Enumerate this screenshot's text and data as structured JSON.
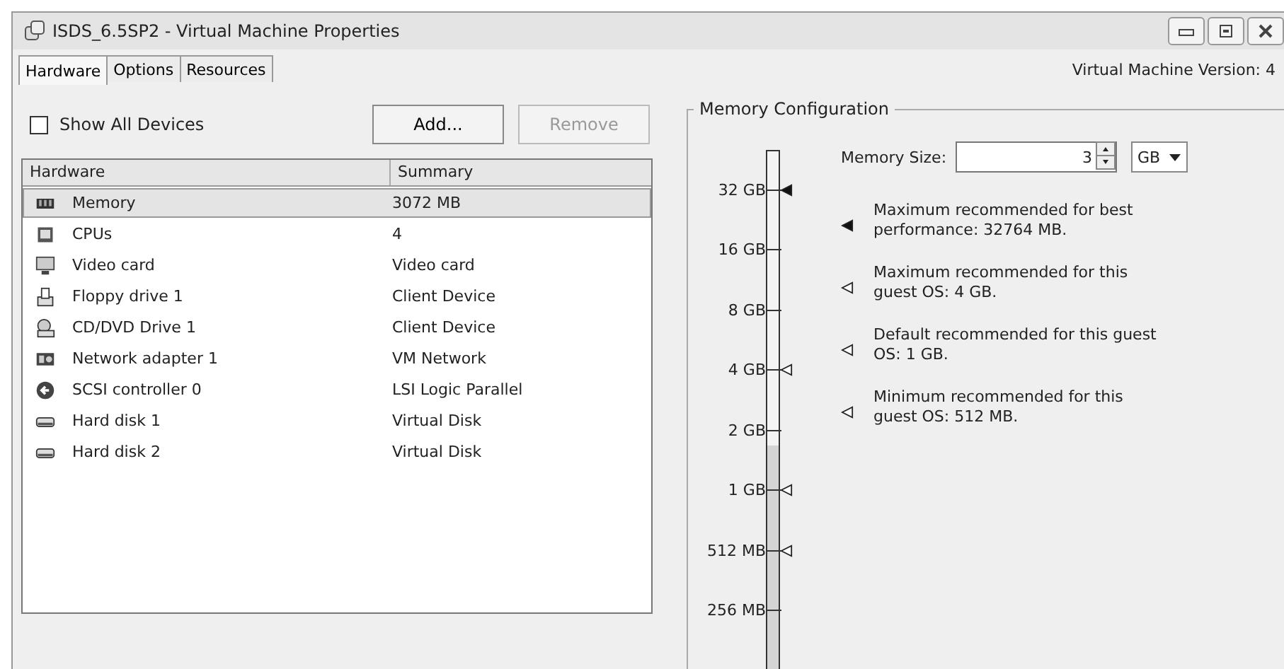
{
  "window": {
    "title": "ISDS_6.5SP2 - Virtual Machine Properties"
  },
  "tabs": [
    {
      "label": "Hardware",
      "selected": true
    },
    {
      "label": "Options",
      "selected": false
    },
    {
      "label": "Resources",
      "selected": false
    }
  ],
  "version": "Virtual Machine Version: 4",
  "show_all_devices": {
    "label": "Show All Devices",
    "checked": false
  },
  "buttons": [
    {
      "label": "Add...",
      "disabled": false
    },
    {
      "label": "Remove",
      "disabled": true
    }
  ],
  "table": {
    "columns": [
      "Hardware",
      "Summary"
    ],
    "rows": [
      {
        "kind": "memory",
        "name": "Memory",
        "summary": "3072 MB",
        "selected": true
      },
      {
        "kind": "cpu",
        "name": "CPUs",
        "summary": "4",
        "selected": false
      },
      {
        "kind": "display",
        "name": "Video card",
        "summary": "Video card",
        "selected": false
      },
      {
        "kind": "floppy",
        "name": "Floppy drive 1",
        "summary": "Client Device",
        "selected": false
      },
      {
        "kind": "cd",
        "name": "CD/DVD Drive 1",
        "summary": "Client Device",
        "selected": false
      },
      {
        "kind": "network",
        "name": "Network adapter 1",
        "summary": "VM Network",
        "selected": false
      },
      {
        "kind": "scsi",
        "name": "SCSI controller 0",
        "summary": "LSI Logic Parallel",
        "selected": false
      },
      {
        "kind": "disk",
        "name": "Hard disk 1",
        "summary": "Virtual Disk",
        "selected": false
      },
      {
        "kind": "disk",
        "name": "Hard disk 2",
        "summary": "Virtual Disk",
        "selected": false
      }
    ]
  },
  "memory": {
    "title": "Memory Configuration",
    "size_label": "Memory Size:",
    "size": "3",
    "unit": "GB",
    "slider": {
      "level": 0.48,
      "ticks": [
        {
          "label": "32 GB",
          "marker": true,
          "filled": true
        },
        {
          "label": "16 GB",
          "marker": false
        },
        {
          "label": "8 GB",
          "marker": false
        },
        {
          "label": "4 GB",
          "marker": true,
          "filled": false
        },
        {
          "label": "2 GB",
          "marker": false
        },
        {
          "label": "1 GB",
          "marker": true,
          "filled": false
        },
        {
          "label": "512 MB",
          "marker": true,
          "filled": false
        },
        {
          "label": "256 MB",
          "marker": false
        }
      ]
    },
    "legend": [
      {
        "filled": true,
        "text": "Maximum recommended for best performance: 32764 MB."
      },
      {
        "filled": false,
        "text": "Maximum recommended for this guest OS: 4 GB."
      },
      {
        "filled": false,
        "text": "Default recommended for this guest OS: 1 GB."
      },
      {
        "filled": false,
        "text": "Minimum recommended for this guest OS: 512 MB."
      }
    ]
  }
}
